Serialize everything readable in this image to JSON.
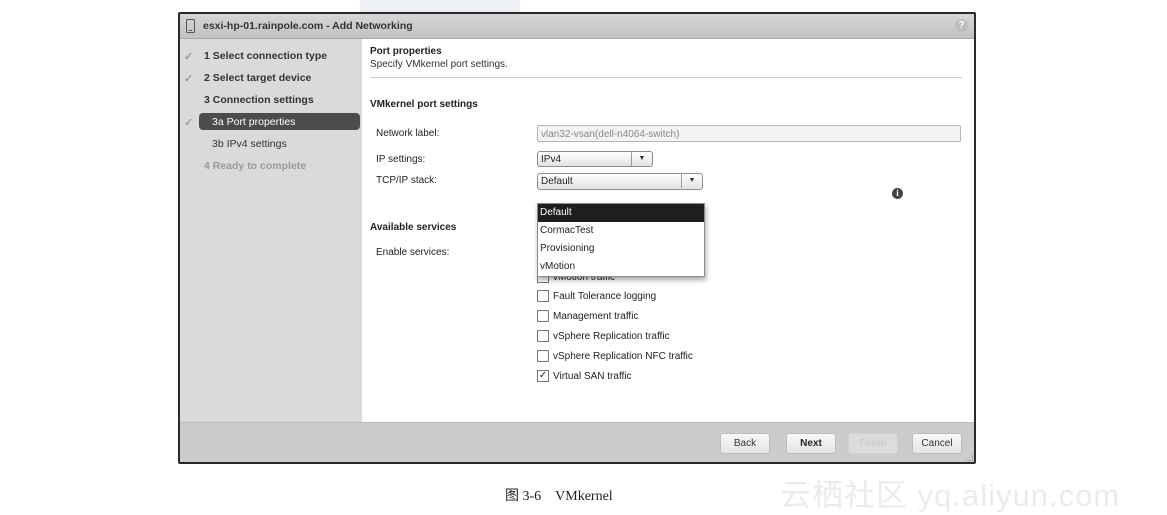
{
  "window": {
    "title": "esxi-hp-01.rainpole.com - Add Networking",
    "help_label": "?"
  },
  "sidebar": {
    "steps": [
      {
        "label": "1  Select connection type",
        "state": "completed"
      },
      {
        "label": "2  Select target device",
        "state": "completed"
      },
      {
        "label": "3  Connection settings",
        "state": "current-group"
      },
      {
        "label": "3a  Port properties",
        "state": "active"
      },
      {
        "label": "3b  IPv4 settings",
        "state": "pending"
      },
      {
        "label": "4  Ready to complete",
        "state": "disabled"
      }
    ],
    "check_glyph": "✓"
  },
  "content": {
    "title": "Port properties",
    "subtitle": "Specify VMkernel port settings.",
    "section_port": "VMkernel port settings",
    "network_label": {
      "label": "Network label:",
      "value": "vlan32-vsan(dell-n4064-switch)"
    },
    "ip_settings": {
      "label": "IP settings:",
      "value": "IPv4"
    },
    "tcpip_stack": {
      "label": "TCP/IP stack:",
      "value": "Default",
      "options": [
        "Default",
        "CormacTest",
        "Provisioning",
        "vMotion"
      ],
      "selected_index": 0
    },
    "section_services": "Available services",
    "enable_services_label": "Enable services:",
    "services": [
      {
        "label": "vMotion traffic",
        "checked": false
      },
      {
        "label": "Fault Tolerance logging",
        "checked": false
      },
      {
        "label": "Management traffic",
        "checked": false
      },
      {
        "label": "vSphere Replication traffic",
        "checked": false
      },
      {
        "label": "vSphere Replication NFC traffic",
        "checked": false
      },
      {
        "label": "Virtual SAN traffic",
        "checked": true
      }
    ]
  },
  "footer": {
    "back": "Back",
    "next": "Next",
    "finish": "Finish",
    "cancel": "Cancel"
  },
  "caption": "图 3-6　VMkernel",
  "watermark": "云栖社区 yq.aliyun.com"
}
